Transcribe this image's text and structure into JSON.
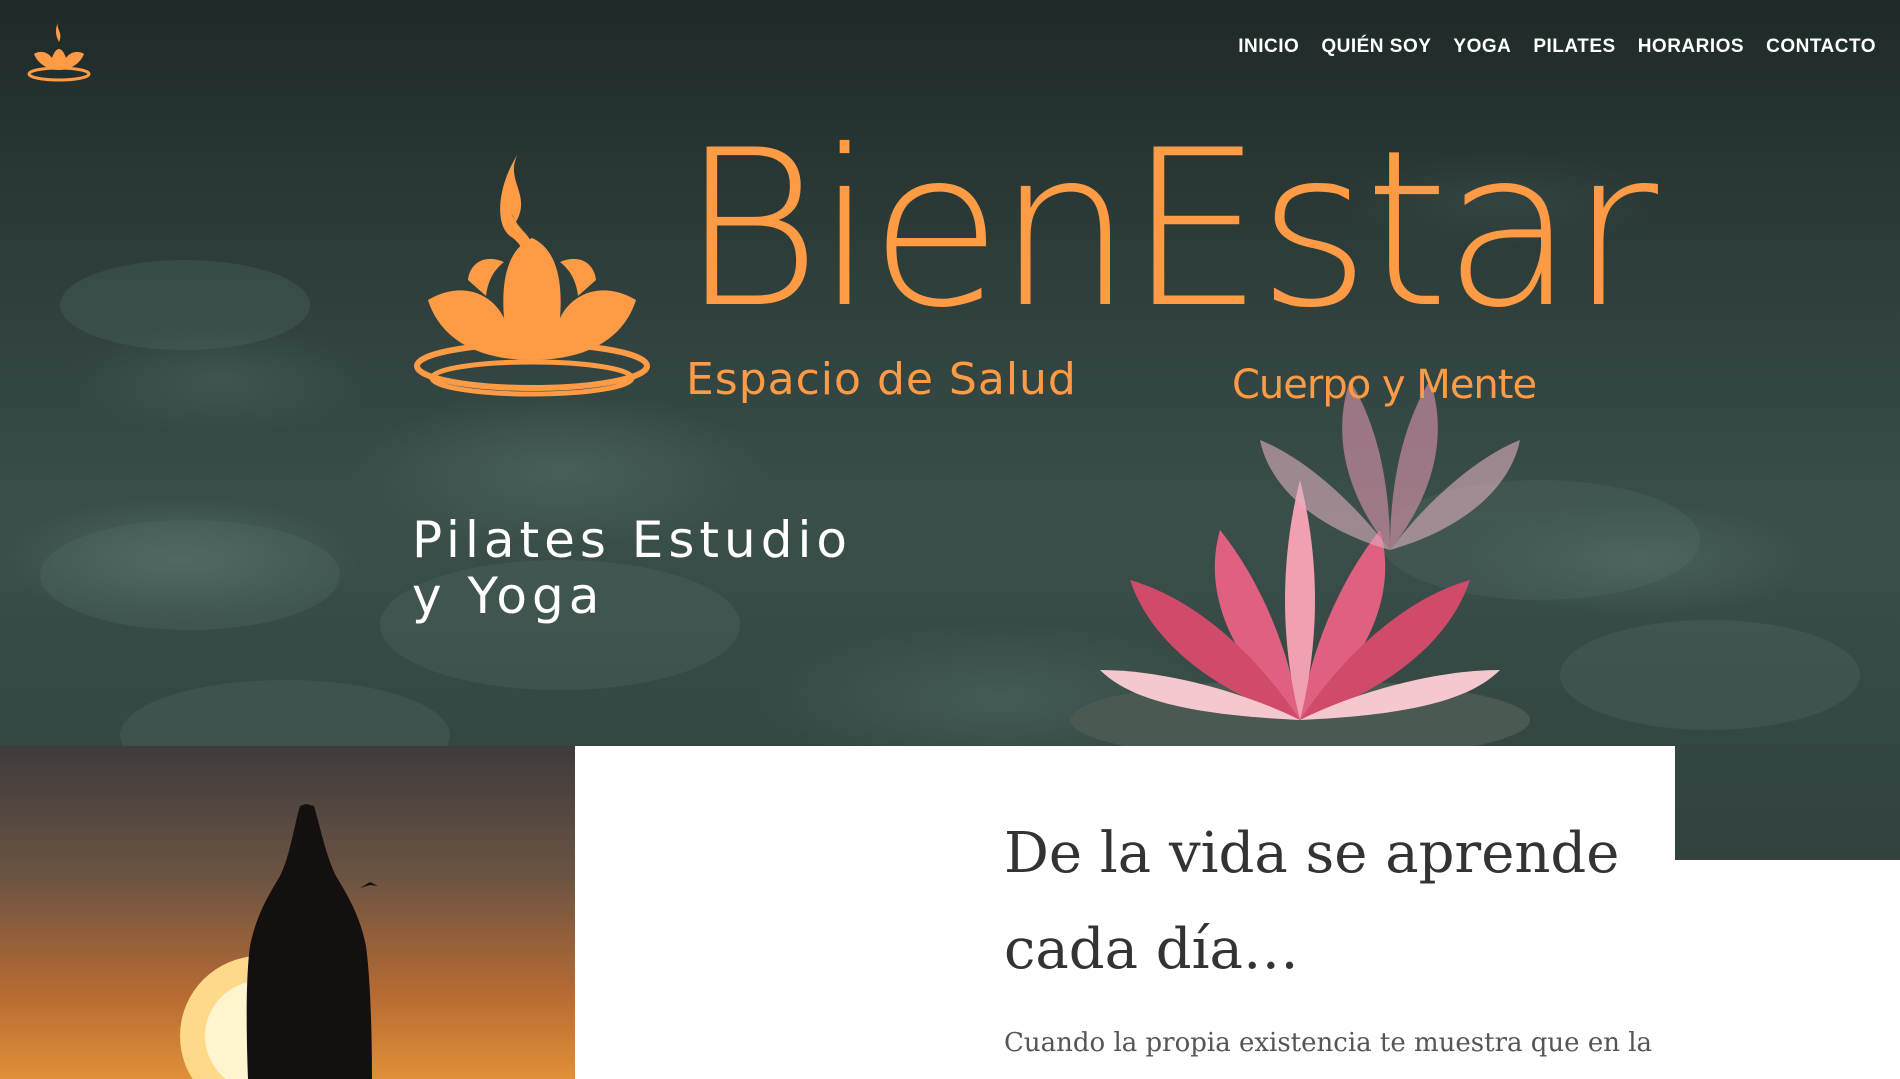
{
  "nav": {
    "items": [
      {
        "label": "INICIO"
      },
      {
        "label": "QUIÉN SOY"
      },
      {
        "label": "YOGA"
      },
      {
        "label": "PILATES"
      },
      {
        "label": "HORARIOS"
      },
      {
        "label": "CONTACTO"
      }
    ]
  },
  "hero": {
    "brand": "BienEstar",
    "brand_sub_left": "Espacio de Salud",
    "brand_sub_right": "Cuerpo y Mente",
    "tagline_line1": "Pilates Estudio",
    "tagline_line2": "y Yoga"
  },
  "content": {
    "heading": "De la vida se aprende cada día…",
    "body": "Cuando la propia existencia te muestra que en la"
  },
  "colors": {
    "brand_orange": "#ff9a45",
    "heading_dark": "#333333",
    "text_gray": "#555555"
  },
  "icons": {
    "logo": "lotus-flame-icon"
  }
}
